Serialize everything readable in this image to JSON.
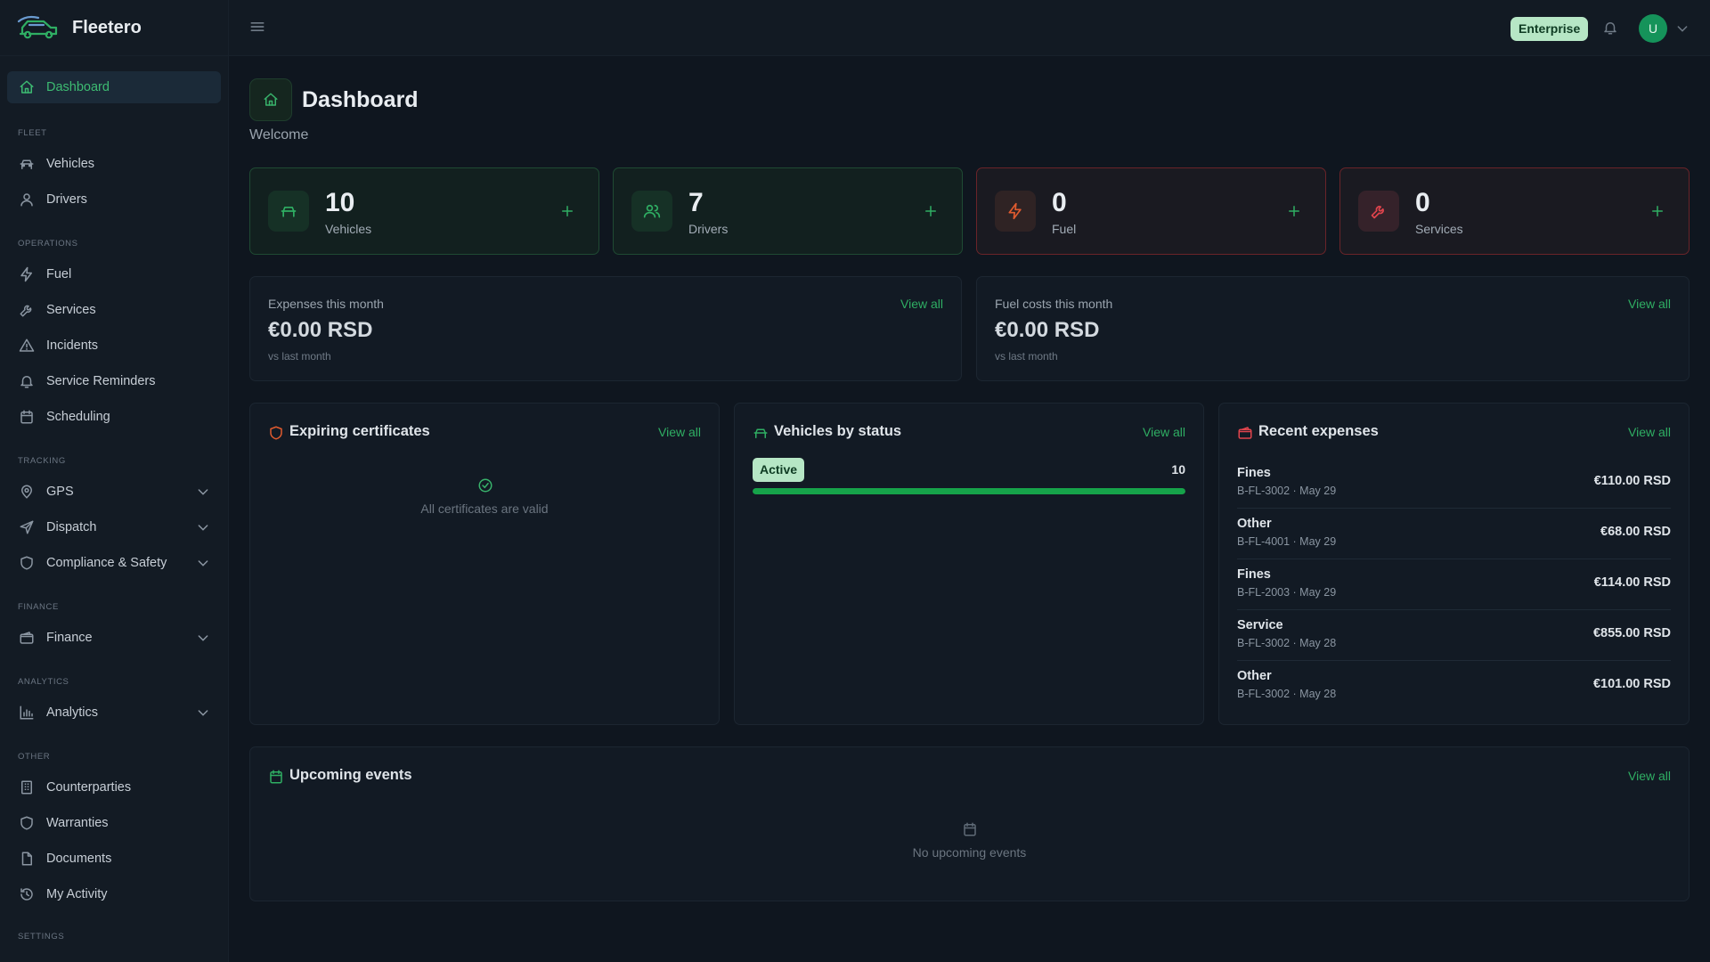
{
  "app": {
    "name": "Fleetero",
    "plan_badge": "Enterprise",
    "user_initial": "U"
  },
  "colors": {
    "accent": "#2fae63",
    "danger": "#e0444d",
    "warning": "#e05b2f",
    "background": "#0f161f"
  },
  "sidebar": {
    "dashboard": {
      "label": "Dashboard",
      "icon": "home-icon"
    },
    "sections": [
      {
        "title": "FLEET",
        "items": [
          {
            "label": "Vehicles",
            "icon": "car-icon",
            "expandable": false
          },
          {
            "label": "Drivers",
            "icon": "user-icon",
            "expandable": false
          }
        ]
      },
      {
        "title": "OPERATIONS",
        "items": [
          {
            "label": "Fuel",
            "icon": "bolt-icon",
            "expandable": false
          },
          {
            "label": "Services",
            "icon": "wrench-icon",
            "expandable": false
          },
          {
            "label": "Incidents",
            "icon": "warning-icon",
            "expandable": false
          },
          {
            "label": "Service Reminders",
            "icon": "bell-icon",
            "expandable": false
          },
          {
            "label": "Scheduling",
            "icon": "calendar-icon",
            "expandable": false
          }
        ]
      },
      {
        "title": "TRACKING",
        "items": [
          {
            "label": "GPS",
            "icon": "map-pin-icon",
            "expandable": true
          },
          {
            "label": "Dispatch",
            "icon": "send-icon",
            "expandable": true
          },
          {
            "label": "Compliance & Safety",
            "icon": "shield-icon",
            "expandable": true
          }
        ]
      },
      {
        "title": "FINANCE",
        "items": [
          {
            "label": "Finance",
            "icon": "wallet-icon",
            "expandable": true
          }
        ]
      },
      {
        "title": "ANALYTICS",
        "items": [
          {
            "label": "Analytics",
            "icon": "bar-chart-icon",
            "expandable": true
          }
        ]
      },
      {
        "title": "OTHER",
        "items": [
          {
            "label": "Counterparties",
            "icon": "building-icon",
            "expandable": false
          },
          {
            "label": "Warranties",
            "icon": "shield-icon",
            "expandable": false
          },
          {
            "label": "Documents",
            "icon": "file-icon",
            "expandable": false
          },
          {
            "label": "My Activity",
            "icon": "history-icon",
            "expandable": false
          }
        ]
      },
      {
        "title": "SETTINGS",
        "items": []
      }
    ]
  },
  "page": {
    "title": "Dashboard",
    "subtitle": "Welcome"
  },
  "stats": [
    {
      "value": "10",
      "label": "Vehicles",
      "tone": "green",
      "icon": "car-icon"
    },
    {
      "value": "7",
      "label": "Drivers",
      "tone": "green",
      "icon": "users-icon"
    },
    {
      "value": "0",
      "label": "Fuel",
      "tone": "red",
      "icon": "bolt-icon"
    },
    {
      "value": "0",
      "label": "Services",
      "tone": "red",
      "icon": "wrench-icon"
    }
  ],
  "expenses_month": {
    "label": "Expenses this month",
    "amount": "€0.00 RSD",
    "note": "vs last month",
    "link": "View all"
  },
  "fuel_month": {
    "label": "Fuel costs this month",
    "amount": "€0.00 RSD",
    "note": "vs last month",
    "link": "View all"
  },
  "certificates": {
    "title": "Expiring certificates",
    "link": "View all",
    "empty_text": "All certificates are valid"
  },
  "vehicles_status": {
    "title": "Vehicles by status",
    "link": "View all",
    "status": "Active",
    "count": "10",
    "fill_fraction": 1.0
  },
  "recent_expenses": {
    "title": "Recent expenses",
    "link": "View all",
    "rows": [
      {
        "category": "Fines",
        "meta": "B-FL-3002 · May 29",
        "amount": "€110.00 RSD"
      },
      {
        "category": "Other",
        "meta": "B-FL-4001 · May 29",
        "amount": "€68.00 RSD"
      },
      {
        "category": "Fines",
        "meta": "B-FL-2003 · May 29",
        "amount": "€114.00 RSD"
      },
      {
        "category": "Service",
        "meta": "B-FL-3002 · May 28",
        "amount": "€855.00 RSD"
      },
      {
        "category": "Other",
        "meta": "B-FL-3002 · May 28",
        "amount": "€101.00 RSD"
      }
    ]
  },
  "upcoming": {
    "title": "Upcoming events",
    "link": "View all",
    "empty_text": "No upcoming events"
  }
}
